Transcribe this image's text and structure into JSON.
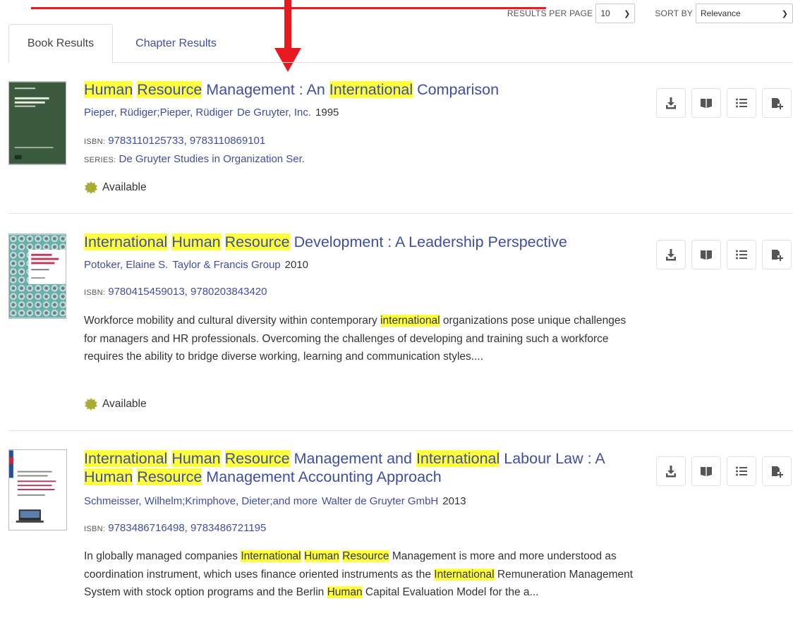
{
  "controls": {
    "results_per_page_label": "RESULTS PER PAGE",
    "results_per_page_value": "10",
    "sort_by_label": "SORT BY",
    "sort_by_value": "Relevance"
  },
  "tabs": [
    {
      "label": "Book Results",
      "active": true
    },
    {
      "label": "Chapter Results",
      "active": false
    }
  ],
  "icons": {
    "download": "download-icon",
    "read": "book-open-icon",
    "toc": "list-icon",
    "add": "add-to-list-icon",
    "available": "available-badge-icon",
    "dropdown": "chevron-down-icon"
  },
  "colors": {
    "link": "#3e4ea3",
    "highlight": "#ffff3c",
    "available": "#a8ad32",
    "annotation": "#e8191f"
  },
  "results": [
    {
      "title_parts": [
        {
          "text": "Human",
          "hl": true
        },
        {
          "text": " ",
          "hl": false
        },
        {
          "text": "Resource",
          "hl": true
        },
        {
          "text": " Management : An ",
          "hl": false
        },
        {
          "text": "International",
          "hl": true
        },
        {
          "text": " Comparison",
          "hl": false
        }
      ],
      "authors": "Pieper, Rüdiger;Pieper, Rüdiger",
      "publisher": "De Gruyter, Inc.",
      "year": "1995",
      "isbn_label": "ISBN:",
      "isbn": "9783110125733, 9783110869101",
      "series_label": "SERIES:",
      "series": "De Gruyter Studies in Organization Ser.",
      "availability": "Available"
    },
    {
      "title_parts": [
        {
          "text": "International",
          "hl": true
        },
        {
          "text": " ",
          "hl": false
        },
        {
          "text": "Human",
          "hl": true
        },
        {
          "text": " ",
          "hl": false
        },
        {
          "text": "Resource",
          "hl": true
        },
        {
          "text": " Development : A Leadership Perspective",
          "hl": false
        }
      ],
      "authors": "Potoker, Elaine S.",
      "publisher": "Taylor & Francis Group",
      "year": "2010",
      "isbn_label": "ISBN:",
      "isbn": "9780415459013, 9780203843420",
      "description_parts": [
        {
          "text": "Workforce mobility and cultural diversity within contemporary ",
          "hl": false
        },
        {
          "text": "international",
          "hl": true
        },
        {
          "text": " organizations pose unique challenges for managers and HR professionals. Overcoming the challenges of developing and training such a workforce requires the ability to bridge diverse working, learning and communication styles....",
          "hl": false
        }
      ],
      "availability": "Available"
    },
    {
      "title_parts": [
        {
          "text": "International",
          "hl": true
        },
        {
          "text": " ",
          "hl": false
        },
        {
          "text": "Human",
          "hl": true
        },
        {
          "text": " ",
          "hl": false
        },
        {
          "text": "Resource",
          "hl": true
        },
        {
          "text": " Management and ",
          "hl": false
        },
        {
          "text": "International",
          "hl": true
        },
        {
          "text": " Labour Law : A ",
          "hl": false
        },
        {
          "text": "Human",
          "hl": true
        },
        {
          "text": " ",
          "hl": false
        },
        {
          "text": "Resource",
          "hl": true
        },
        {
          "text": " Management Accounting Approach",
          "hl": false
        }
      ],
      "authors": "Schmeisser, Wilhelm;Krimphove, Dieter;and more",
      "publisher": "Walter de Gruyter GmbH",
      "year": "2013",
      "isbn_label": "ISBN:",
      "isbn": "9783486716498, 9783486721195",
      "description_parts": [
        {
          "text": "In globally managed companies ",
          "hl": false
        },
        {
          "text": "International",
          "hl": true
        },
        {
          "text": " ",
          "hl": false
        },
        {
          "text": "Human",
          "hl": true
        },
        {
          "text": " ",
          "hl": false
        },
        {
          "text": "Resource",
          "hl": true
        },
        {
          "text": " Management is more and more understood as coordination instrument, which uses finance oriented instruments as the ",
          "hl": false
        },
        {
          "text": "International",
          "hl": true
        },
        {
          "text": " Remuneration Management System with stock option programs and the Berlin ",
          "hl": false
        },
        {
          "text": "Human",
          "hl": true
        },
        {
          "text": " Capital Evaluation Model for the a...",
          "hl": false
        }
      ]
    }
  ]
}
